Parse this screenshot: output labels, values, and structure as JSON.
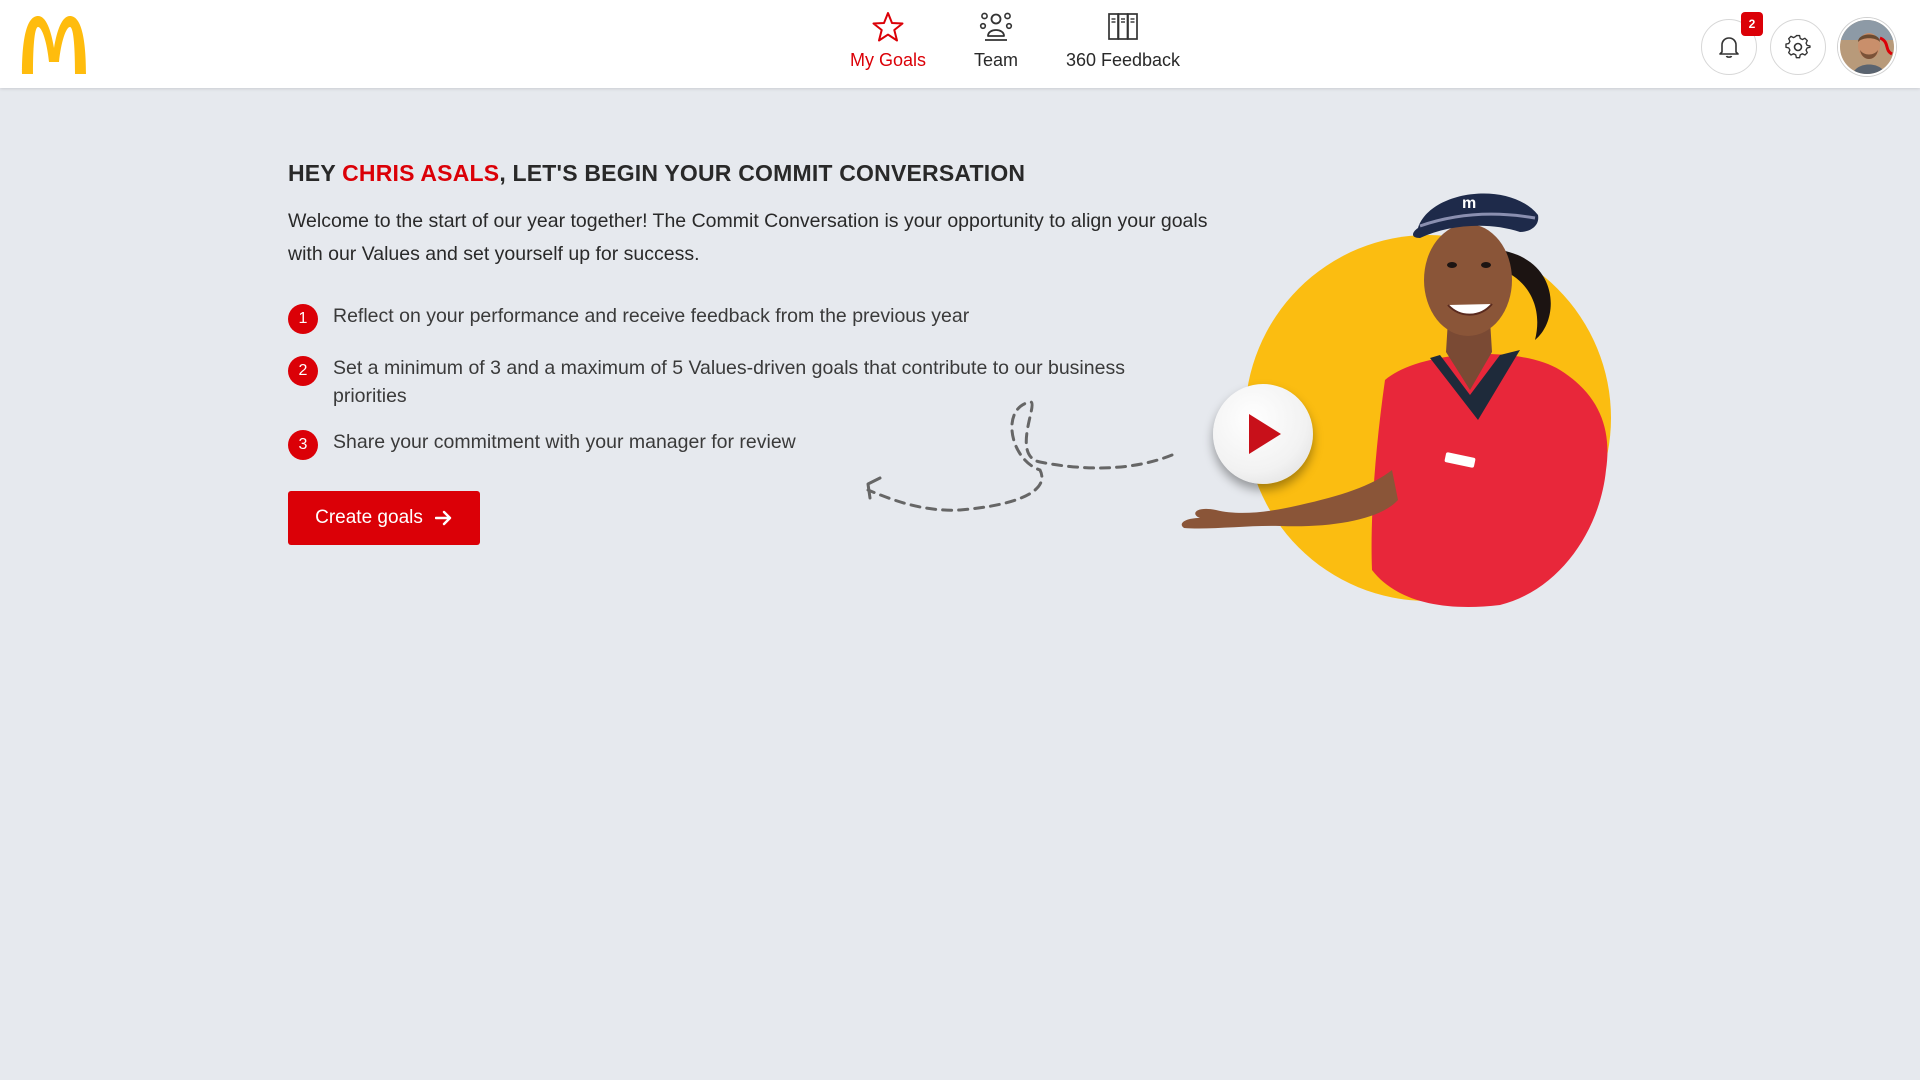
{
  "brand": {
    "logo_icon": "golden-arches-logo",
    "accent": "#db0007",
    "logo_color": "#ffbc0d"
  },
  "nav": {
    "items": [
      {
        "label": "My Goals",
        "icon": "star-icon",
        "active": true
      },
      {
        "label": "Team",
        "icon": "team-icon",
        "active": false
      },
      {
        "label": "360 Feedback",
        "icon": "binders-icon",
        "active": false
      }
    ]
  },
  "header_actions": {
    "notifications_icon": "bell-icon",
    "notification_count": "2",
    "settings_icon": "gear-icon",
    "avatar_icon": "user-avatar"
  },
  "main": {
    "headline_prefix": "HEY ",
    "user_name": "CHRIS ASALS",
    "headline_suffix": ", LET'S BEGIN YOUR COMMIT CONVERSATION",
    "intro": "Welcome to the start of our year together! The Commit Conversation is your opportunity to align your goals with our Values and set yourself up for success.",
    "steps": [
      {
        "number": "1",
        "text": "Reflect on your performance and receive feedback from the previous year"
      },
      {
        "number": "2",
        "text": "Set a minimum of 3 and a maximum of 5 Values-driven goals that contribute to our business priorities"
      },
      {
        "number": "3",
        "text": "Share your commitment with your manager for review"
      }
    ],
    "cta_label": "Create goals",
    "cta_icon": "arrow-right-icon"
  },
  "hero": {
    "play_icon": "play-icon",
    "circle_color": "#fbbd11",
    "illustration": "crew-member-presenting"
  }
}
